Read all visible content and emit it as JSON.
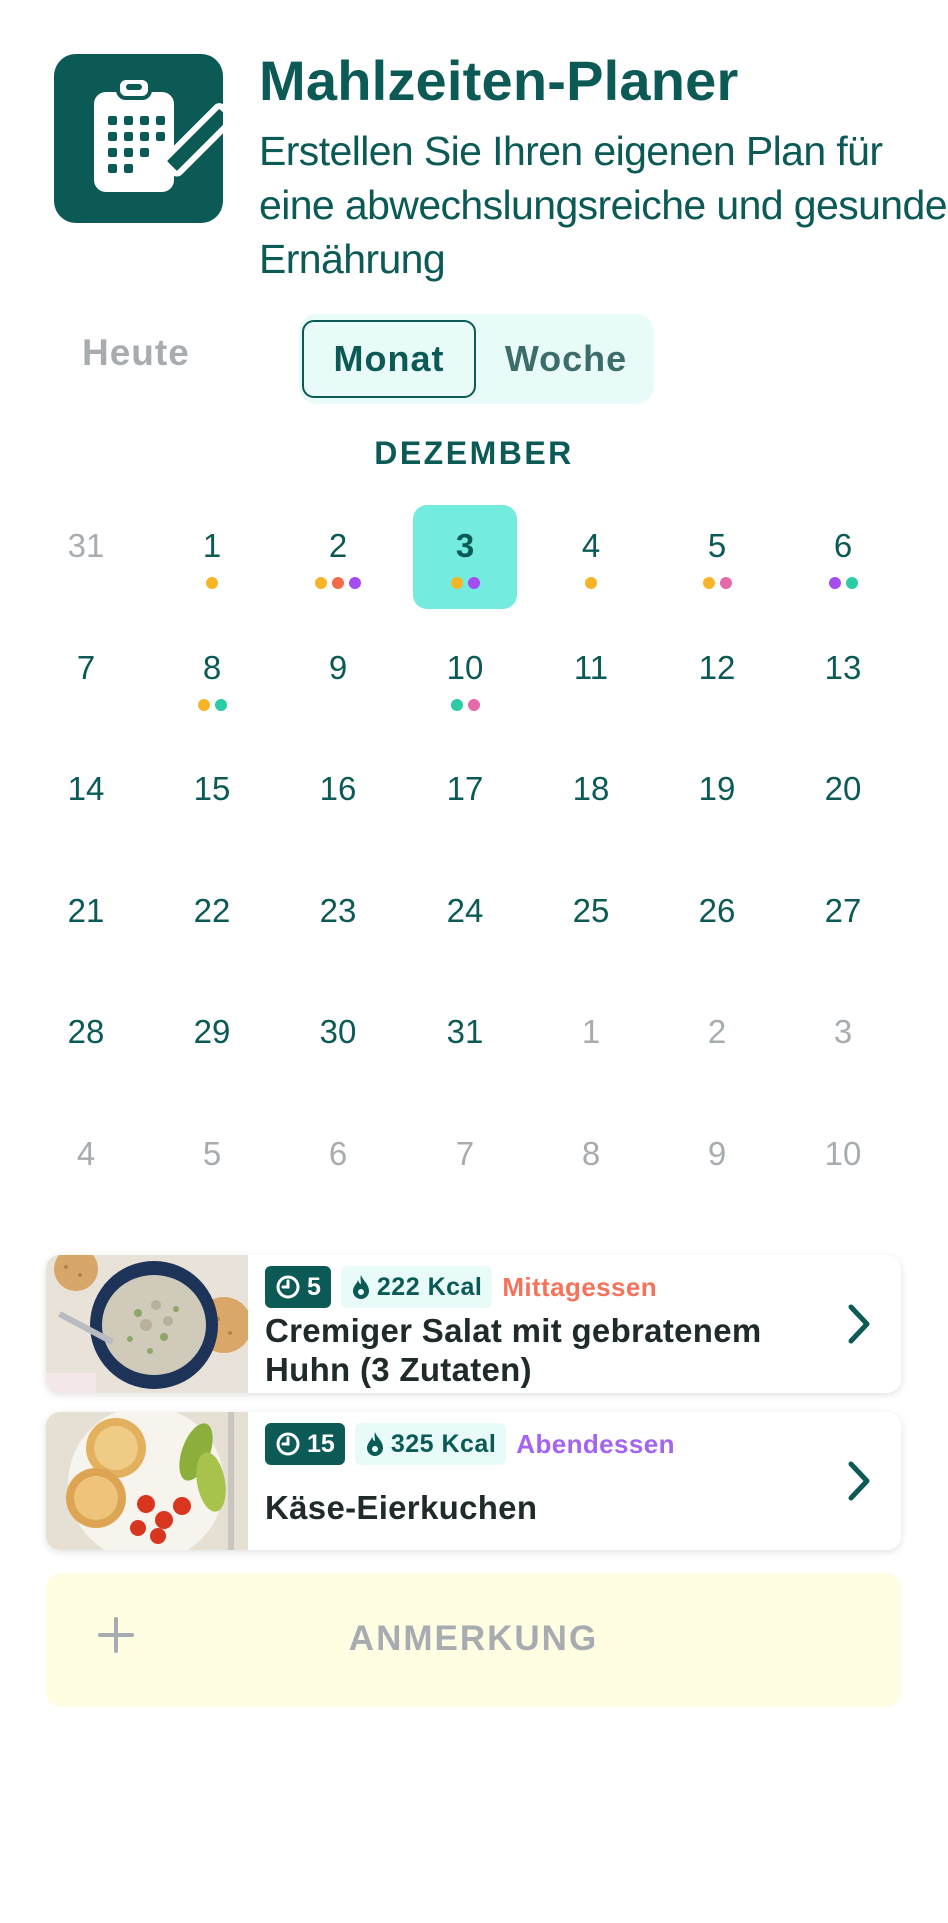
{
  "header": {
    "title": "Mahlzeiten-Planer",
    "subtitle": "Erstellen Sie Ihren eigenen Plan für eine abwechslungsreiche und gesunde Ernährung",
    "icon": "clipboard-calendar-pencil-icon"
  },
  "view_switch": {
    "today_label": "Heute",
    "month_label": "Monat",
    "week_label": "Woche",
    "selected": "Monat"
  },
  "calendar": {
    "month_name": "DEZEMBER",
    "selected_day": "3",
    "dot_colors": {
      "orange": "#f6b426",
      "red": "#f46b4a",
      "purple": "#a54cf0",
      "teal": "#2bcba5",
      "pink": "#e66aa8"
    },
    "weeks": [
      [
        {
          "day": "31",
          "muted": true,
          "dots": []
        },
        {
          "day": "1",
          "muted": false,
          "dots": [
            "orange"
          ]
        },
        {
          "day": "2",
          "muted": false,
          "dots": [
            "orange",
            "red",
            "purple"
          ]
        },
        {
          "day": "3",
          "muted": false,
          "dots": [
            "orange",
            "purple"
          ],
          "selected": true
        },
        {
          "day": "4",
          "muted": false,
          "dots": [
            "orange"
          ]
        },
        {
          "day": "5",
          "muted": false,
          "dots": [
            "orange",
            "pink"
          ]
        },
        {
          "day": "6",
          "muted": false,
          "dots": [
            "purple",
            "teal"
          ]
        }
      ],
      [
        {
          "day": "7",
          "muted": false,
          "dots": []
        },
        {
          "day": "8",
          "muted": false,
          "dots": [
            "orange",
            "teal"
          ]
        },
        {
          "day": "9",
          "muted": false,
          "dots": []
        },
        {
          "day": "10",
          "muted": false,
          "dots": [
            "teal",
            "pink"
          ]
        },
        {
          "day": "11",
          "muted": false,
          "dots": []
        },
        {
          "day": "12",
          "muted": false,
          "dots": []
        },
        {
          "day": "13",
          "muted": false,
          "dots": []
        }
      ],
      [
        {
          "day": "14",
          "muted": false,
          "dots": []
        },
        {
          "day": "15",
          "muted": false,
          "dots": []
        },
        {
          "day": "16",
          "muted": false,
          "dots": []
        },
        {
          "day": "17",
          "muted": false,
          "dots": []
        },
        {
          "day": "18",
          "muted": false,
          "dots": []
        },
        {
          "day": "19",
          "muted": false,
          "dots": []
        },
        {
          "day": "20",
          "muted": false,
          "dots": []
        }
      ],
      [
        {
          "day": "21",
          "muted": false,
          "dots": []
        },
        {
          "day": "22",
          "muted": false,
          "dots": []
        },
        {
          "day": "23",
          "muted": false,
          "dots": []
        },
        {
          "day": "24",
          "muted": false,
          "dots": []
        },
        {
          "day": "25",
          "muted": false,
          "dots": []
        },
        {
          "day": "26",
          "muted": false,
          "dots": []
        },
        {
          "day": "27",
          "muted": false,
          "dots": []
        }
      ],
      [
        {
          "day": "28",
          "muted": false,
          "dots": []
        },
        {
          "day": "29",
          "muted": false,
          "dots": []
        },
        {
          "day": "30",
          "muted": false,
          "dots": []
        },
        {
          "day": "31",
          "muted": false,
          "dots": []
        },
        {
          "day": "1",
          "muted": true,
          "dots": []
        },
        {
          "day": "2",
          "muted": true,
          "dots": []
        },
        {
          "day": "3",
          "muted": true,
          "dots": []
        }
      ],
      [
        {
          "day": "4",
          "muted": true,
          "dots": []
        },
        {
          "day": "5",
          "muted": true,
          "dots": []
        },
        {
          "day": "6",
          "muted": true,
          "dots": []
        },
        {
          "day": "7",
          "muted": true,
          "dots": []
        },
        {
          "day": "8",
          "muted": true,
          "dots": []
        },
        {
          "day": "9",
          "muted": true,
          "dots": []
        },
        {
          "day": "10",
          "muted": true,
          "dots": []
        }
      ]
    ]
  },
  "meals": [
    {
      "time": "5",
      "kcal": "222 Kcal",
      "type": "Mittagessen",
      "type_color": "#f4735a",
      "name": "Cremiger Salat mit gebratenem Huhn (3 Zutaten)",
      "image": "chicken-salad-bowl-photo"
    },
    {
      "time": "15",
      "kcal": "325 Kcal",
      "type": "Abendessen",
      "type_color": "#a463f0",
      "name": "Käse-Eierkuchen",
      "image": "cheese-pancakes-plate-photo"
    }
  ],
  "note": {
    "label": "ANMERKUNG",
    "icon": "plus-icon"
  },
  "colors": {
    "brand": "#0b5a55",
    "selected_day_bg": "#73ecdf",
    "segment_bg": "#e9fbf8",
    "note_bg": "#fffde2"
  }
}
